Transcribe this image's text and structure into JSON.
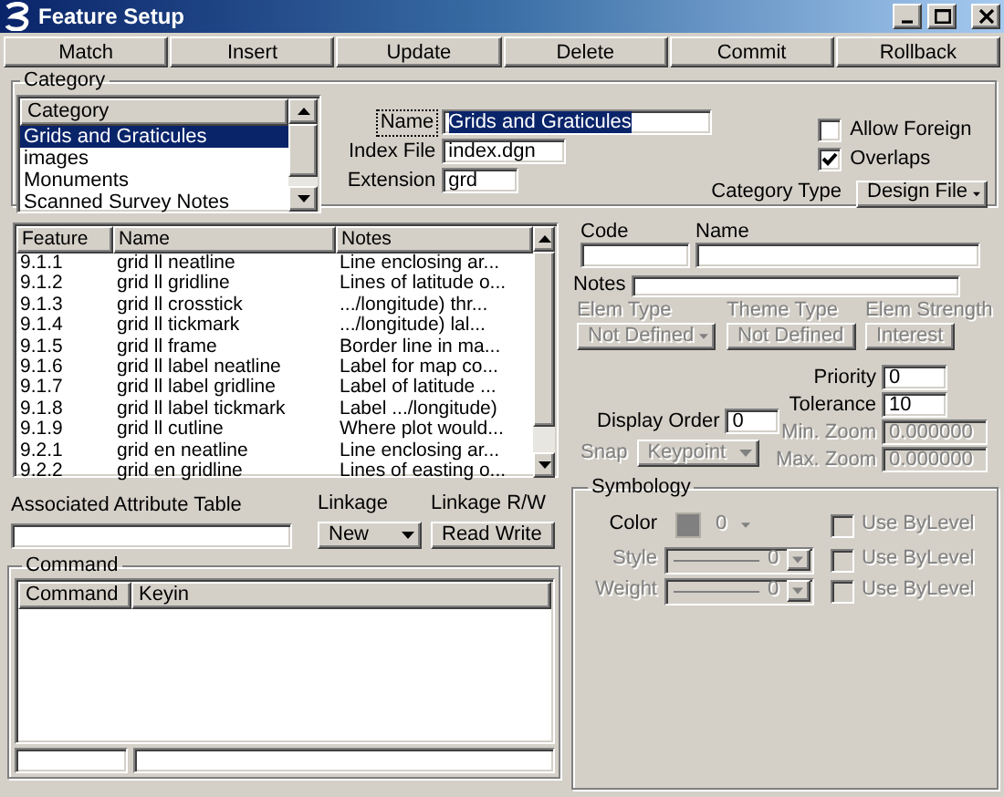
{
  "window": {
    "title": "Feature Setup"
  },
  "toolbar": [
    "Match",
    "Insert",
    "Update",
    "Delete",
    "Commit",
    "Rollback"
  ],
  "category": {
    "legend": "Category",
    "list": {
      "header": "Category",
      "items": [
        {
          "label": "Grids and Graticules",
          "selected": true
        },
        {
          "label": "images",
          "selected": false
        },
        {
          "label": "Monuments",
          "selected": false
        },
        {
          "label": "Scanned Survey Notes",
          "selected": false
        }
      ]
    },
    "name": {
      "label": "Name",
      "value": "Grids and Graticules"
    },
    "index_file": {
      "label": "Index File",
      "value": "index.dgn"
    },
    "extension": {
      "label": "Extension",
      "value": "grd"
    },
    "allow_foreign": {
      "label": "Allow Foreign",
      "checked": false
    },
    "overlaps": {
      "label": "Overlaps",
      "checked": true
    },
    "category_type": {
      "label": "Category Type",
      "value": "Design File"
    }
  },
  "features": {
    "columns": [
      "Feature",
      "Name",
      "Notes"
    ],
    "rows": [
      [
        "9.1.1",
        "grid ll neatline",
        "Line enclosing ar..."
      ],
      [
        "9.1.2",
        "grid ll gridline",
        "Lines of latitude o..."
      ],
      [
        "9.1.3",
        "grid ll crosstick",
        ".../longitude) thr..."
      ],
      [
        "9.1.4",
        "grid ll tickmark",
        ".../longitude) lal..."
      ],
      [
        "9.1.5",
        "grid ll frame",
        "Border line in ma..."
      ],
      [
        "9.1.6",
        "grid ll label neatline",
        "Label for map co..."
      ],
      [
        "9.1.7",
        "grid ll label gridline",
        "Label of latitude ..."
      ],
      [
        "9.1.8",
        "grid ll label tickmark",
        "Label .../longitude)"
      ],
      [
        "9.1.9",
        "grid ll cutline",
        "Where plot would..."
      ],
      [
        "9.2.1",
        "grid en neatline",
        "Line enclosing ar..."
      ],
      [
        "9.2.2",
        "grid en gridline",
        "Lines of easting o..."
      ]
    ]
  },
  "attribute_table": {
    "label": "Associated Attribute Table"
  },
  "linkage": {
    "label": "Linkage",
    "value": "New"
  },
  "linkage_rw": {
    "label": "Linkage R/W",
    "value": "Read Write"
  },
  "command": {
    "legend": "Command",
    "columns": [
      "Command",
      "Keyin"
    ]
  },
  "details": {
    "code": {
      "label": "Code"
    },
    "name": {
      "label": "Name"
    },
    "notes": {
      "label": "Notes"
    },
    "elem_type": {
      "label": "Elem Type",
      "value": "Not Defined",
      "disabled": true
    },
    "theme_type": {
      "label": "Theme Type",
      "value": "Not Defined",
      "disabled": true
    },
    "elem_strength": {
      "label": "Elem Strength",
      "value": "Interest",
      "disabled": true
    },
    "priority": {
      "label": "Priority",
      "value": "0",
      "disabled": false
    },
    "tolerance": {
      "label": "Tolerance",
      "value": "10",
      "disabled": false
    },
    "min_zoom": {
      "label": "Min. Zoom",
      "value": "0.000000",
      "disabled": true
    },
    "max_zoom": {
      "label": "Max. Zoom",
      "value": "0.000000",
      "disabled": true
    },
    "display_order": {
      "label": "Display Order",
      "value": "0",
      "disabled": false
    },
    "snap": {
      "label": "Snap",
      "value": "Keypoint",
      "disabled": true
    }
  },
  "symbology": {
    "legend": "Symbology",
    "rows": [
      {
        "kind": "color",
        "label": "Color",
        "value": "0",
        "disabled": false,
        "use_by_level": {
          "label": "Use ByLevel",
          "checked": false,
          "disabled": true
        }
      },
      {
        "kind": "line",
        "label": "Style",
        "value": "0",
        "disabled": true,
        "use_by_level": {
          "label": "Use ByLevel",
          "checked": false,
          "disabled": true
        }
      },
      {
        "kind": "line",
        "label": "Weight",
        "value": "0",
        "disabled": true,
        "use_by_level": {
          "label": "Use ByLevel",
          "checked": false,
          "disabled": true
        }
      }
    ]
  }
}
